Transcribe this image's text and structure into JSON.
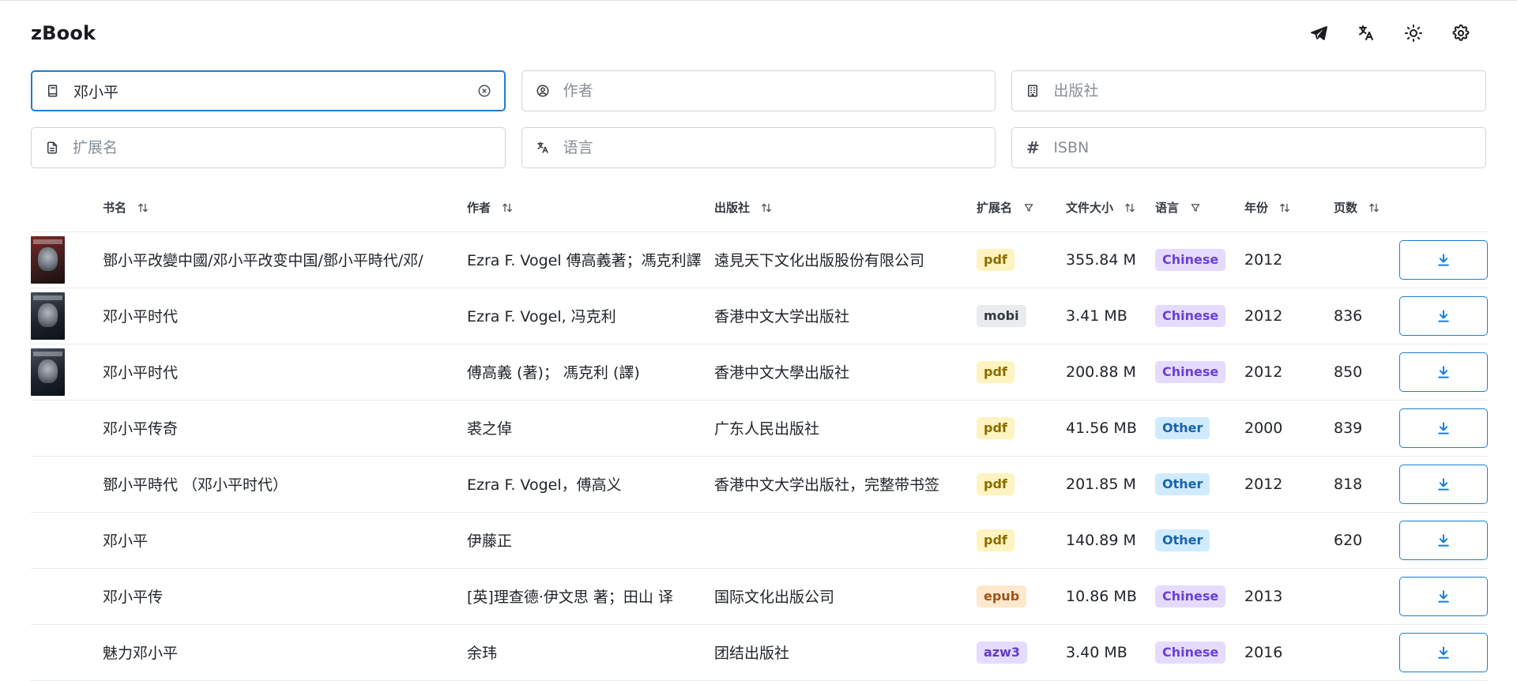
{
  "app": {
    "title": "zBook"
  },
  "header": {
    "icons": [
      "telegram-icon",
      "translate-icon",
      "sun-icon",
      "settings-icon"
    ]
  },
  "filters": {
    "title": {
      "value": "邓小平",
      "placeholder": ""
    },
    "author": {
      "value": "",
      "placeholder": "作者"
    },
    "publisher": {
      "value": "",
      "placeholder": "出版社"
    },
    "extension": {
      "value": "",
      "placeholder": "扩展名"
    },
    "language": {
      "value": "",
      "placeholder": "语言"
    },
    "isbn": {
      "value": "",
      "placeholder": "ISBN"
    }
  },
  "table": {
    "columns": {
      "title": "书名",
      "author": "作者",
      "publisher": "出版社",
      "extension": "扩展名",
      "filesize": "文件大小",
      "language": "语言",
      "year": "年份",
      "pages": "页数"
    },
    "rows": [
      {
        "cover": "red",
        "title": "鄧小平改變中國/邓小平改变中国/鄧小平時代/邓/",
        "author": "Ezra F. Vogel 傅高義著；馮克利譯",
        "publisher": "遠見天下文化出版股份有限公司",
        "ext": "pdf",
        "size": "355.84 M",
        "lang": "Chinese",
        "year": "2012",
        "pages": ""
      },
      {
        "cover": "dark",
        "title": "邓小平时代",
        "author": "Ezra F. Vogel, 冯克利",
        "publisher": "香港中文大学出版社",
        "ext": "mobi",
        "size": "3.41 MB",
        "lang": "Chinese",
        "year": "2012",
        "pages": "836"
      },
      {
        "cover": "dark",
        "title": "邓小平时代",
        "author": "傅高義 (著)； 馮克利 (譯)",
        "publisher": "香港中文大學出版社",
        "ext": "pdf",
        "size": "200.88 M",
        "lang": "Chinese",
        "year": "2012",
        "pages": "850"
      },
      {
        "cover": "",
        "title": "邓小平传奇",
        "author": "裘之倬",
        "publisher": "广东人民出版社",
        "ext": "pdf",
        "size": "41.56 MB",
        "lang": "Other",
        "year": "2000",
        "pages": "839"
      },
      {
        "cover": "",
        "title": "鄧小平時代 （邓小平时代）",
        "author": "Ezra F. Vogel，傅高义",
        "publisher": "香港中文大学出版社，完整带书签",
        "ext": "pdf",
        "size": "201.85 M",
        "lang": "Other",
        "year": "2012",
        "pages": "818"
      },
      {
        "cover": "",
        "title": "邓小平",
        "author": "伊藤正",
        "publisher": "",
        "ext": "pdf",
        "size": "140.89 M",
        "lang": "Other",
        "year": "",
        "pages": "620"
      },
      {
        "cover": "",
        "title": "邓小平传",
        "author": "[英]理查德·伊文思 著；田山 译",
        "publisher": "国际文化出版公司",
        "ext": "epub",
        "size": "10.86 MB",
        "lang": "Chinese",
        "year": "2013",
        "pages": ""
      },
      {
        "cover": "",
        "title": "魅力邓小平",
        "author": "余玮",
        "publisher": "团结出版社",
        "ext": "azw3",
        "size": "3.40 MB",
        "lang": "Chinese",
        "year": "2016",
        "pages": ""
      }
    ]
  },
  "colors": {
    "accent": "#1c7ed6",
    "border": "#ced4da",
    "badge_pdf": "#fff3bf",
    "badge_chinese": "#e5dbff",
    "badge_other": "#d0ebff"
  }
}
